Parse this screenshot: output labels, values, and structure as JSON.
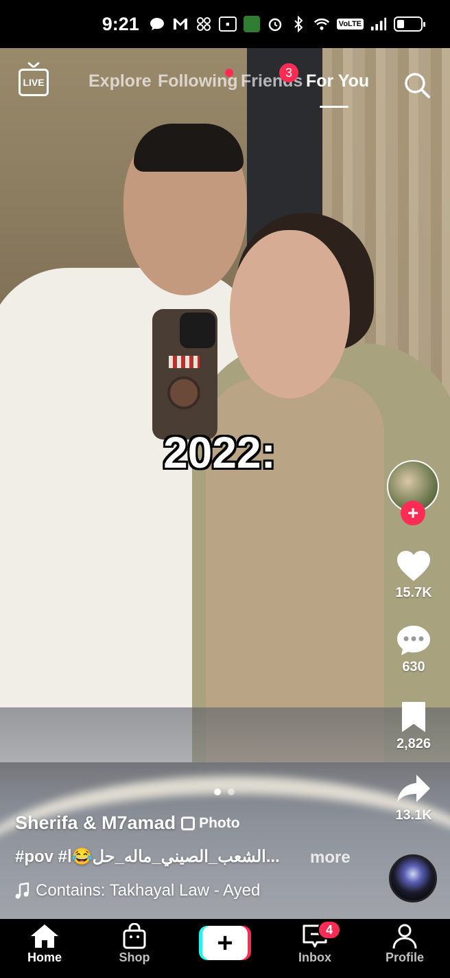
{
  "status_bar": {
    "time": "9:21",
    "network_label": "VoLTE"
  },
  "top_nav": {
    "live_label": "LIVE",
    "tabs": [
      {
        "label": "Explore",
        "active": false
      },
      {
        "label": "Following",
        "active": false,
        "has_dot": true
      },
      {
        "label": "Friends",
        "active": false,
        "badge": "3"
      },
      {
        "label": "For You",
        "active": true
      }
    ]
  },
  "video": {
    "overlay_text": "2022:",
    "page_count": 2,
    "current_page": 1
  },
  "right_rail": {
    "likes": "15.7K",
    "comments": "630",
    "saves": "2,826",
    "shares": "13.1K"
  },
  "caption": {
    "author": "Sherifa & M7amad",
    "media_type": "Photo",
    "description": "#pov #الشعب_الصيني_ماله_حل😂ا...",
    "more_label": "more",
    "sound": "Contains: Takhayal Law - Ayed"
  },
  "bottom_nav": {
    "items": [
      {
        "label": "Home",
        "active": true
      },
      {
        "label": "Shop",
        "active": false
      },
      {
        "label": "Inbox",
        "active": false,
        "badge": "4"
      },
      {
        "label": "Profile",
        "active": false
      }
    ]
  },
  "colors": {
    "accent": "#fe2c55",
    "cyan": "#25f4ee"
  }
}
